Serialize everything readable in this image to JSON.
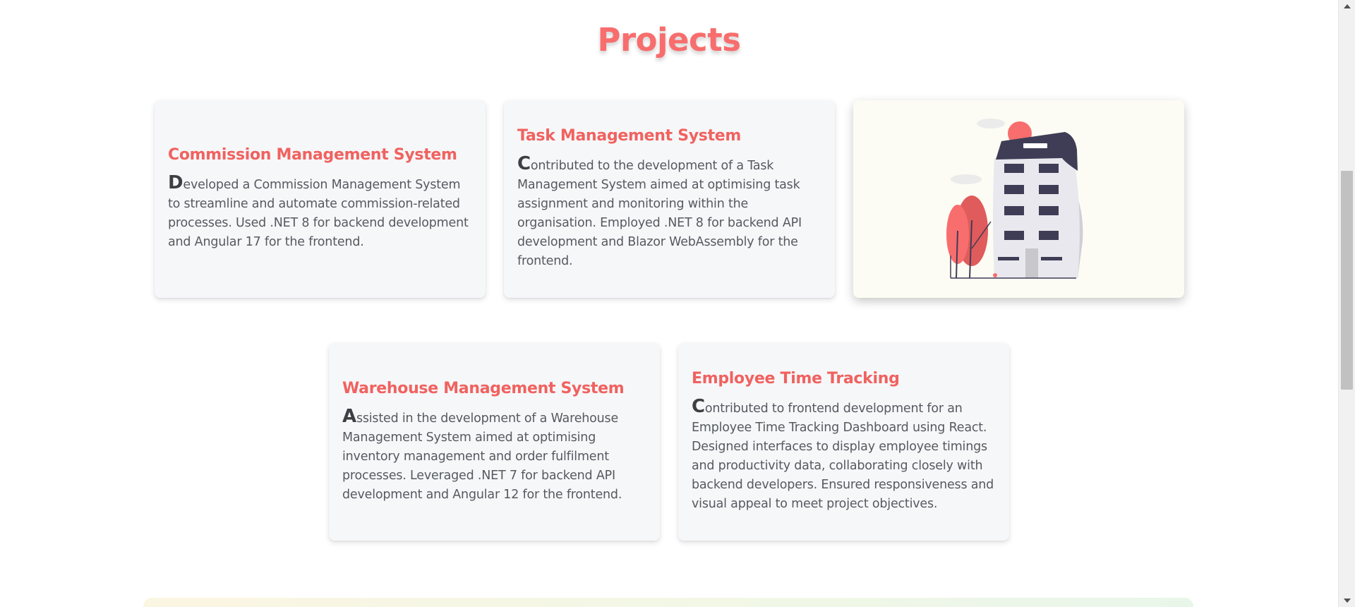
{
  "section": {
    "title": "Projects"
  },
  "projects": [
    {
      "title": "Commission Management System",
      "initial": "D",
      "text": "eveloped a Commission Management System to streamline and automate commission-related processes. Used .NET 8 for backend development and Angular 17 for the frontend."
    },
    {
      "title": "Task Management System",
      "initial": "C",
      "text": "ontributed to the development of a Task Management System aimed at optimising task assignment and monitoring within the organisation. Employed .NET 8 for backend API development and Blazor WebAssembly for the frontend."
    },
    {
      "title": "Warehouse Management System",
      "initial": "A",
      "text": "ssisted in the development of a Warehouse Management System aimed at optimising inventory management and order fulfilment processes. Leveraged .NET 7 for backend API development and Angular 12 for the frontend."
    },
    {
      "title": "Employee Time Tracking",
      "initial": "C",
      "text": "ontributed to frontend development for an Employee Time Tracking Dashboard using React. Designed interfaces to display employee timings and productivity data, collaborating closely with backend developers. Ensured responsiveness and visual appeal to meet project objectives."
    }
  ],
  "illustration": {
    "icon": "office-building-illustration"
  },
  "colors": {
    "accent": "#f86d6d",
    "card_bg": "#f6f7f9",
    "text": "#555a60",
    "building_dark": "#3f3d56"
  }
}
